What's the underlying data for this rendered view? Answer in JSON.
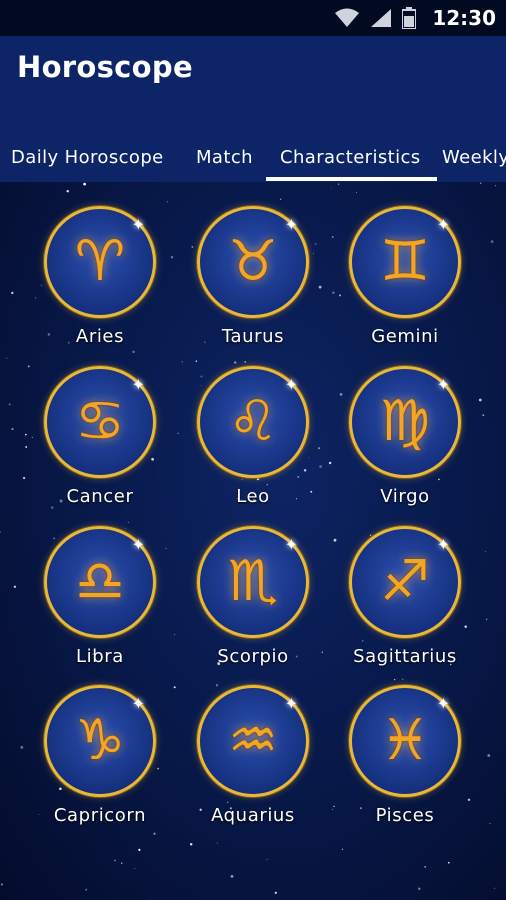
{
  "status_bar": {
    "time": "12:30",
    "icons": [
      "wifi-icon",
      "cellular-signal-icon",
      "battery-icon"
    ]
  },
  "app_bar": {
    "title": "Horoscope",
    "color": "#0d2466"
  },
  "tabs": [
    {
      "label": "Daily Horoscope",
      "selected": false
    },
    {
      "label": "Match",
      "selected": false
    },
    {
      "label": "Characteristics",
      "selected": true
    },
    {
      "label": "Weekly",
      "selected": false
    }
  ],
  "signs": [
    {
      "name": "Aries",
      "icon": "aries-icon",
      "glyph": "♈"
    },
    {
      "name": "Taurus",
      "icon": "taurus-icon",
      "glyph": "♉"
    },
    {
      "name": "Gemini",
      "icon": "gemini-icon",
      "glyph": "♊"
    },
    {
      "name": "Cancer",
      "icon": "cancer-icon",
      "glyph": "♋"
    },
    {
      "name": "Leo",
      "icon": "leo-icon",
      "glyph": "♌"
    },
    {
      "name": "Virgo",
      "icon": "virgo-icon",
      "glyph": "♍"
    },
    {
      "name": "Libra",
      "icon": "libra-icon",
      "glyph": "♎"
    },
    {
      "name": "Scorpio",
      "icon": "scorpio-icon",
      "glyph": "♏"
    },
    {
      "name": "Sagittarius",
      "icon": "sagittarius-icon",
      "glyph": "♐"
    },
    {
      "name": "Capricorn",
      "icon": "capricorn-icon",
      "glyph": "♑"
    },
    {
      "name": "Aquarius",
      "icon": "aquarius-icon",
      "glyph": "♒"
    },
    {
      "name": "Pisces",
      "icon": "pisces-icon",
      "glyph": "♓"
    }
  ],
  "colors": {
    "background": "#061236",
    "medallion_rim": "#e8b83a",
    "medallion_fill": "#15307e",
    "glyph": "#f3a524"
  }
}
